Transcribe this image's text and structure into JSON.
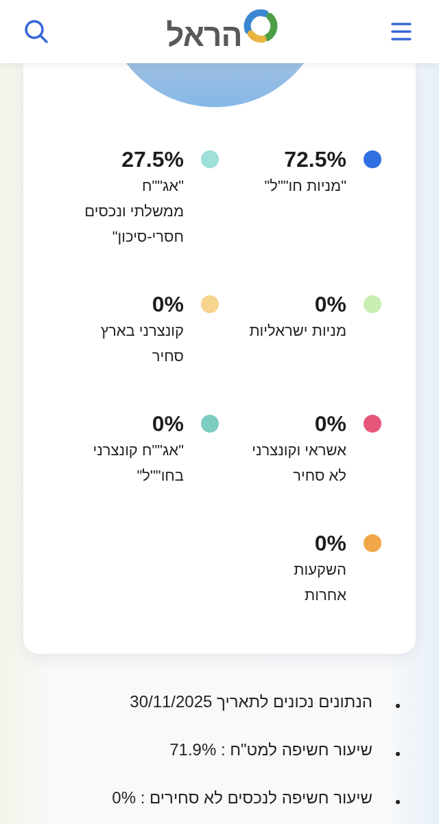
{
  "header": {
    "brand_name": "הראל"
  },
  "chart": {
    "legend": [
      {
        "percent": "72.5%",
        "label": "\"מניות חו\"\"ל\"",
        "color": "#2f6fe0"
      },
      {
        "percent": "27.5%",
        "label": "\"אג\"\"ח\nממשלתי ונכסים\nחסרי-סיכון\"",
        "color": "#9fdfd9"
      },
      {
        "percent": "0%",
        "label": "מניות ישראליות",
        "color": "#c8eeb4"
      },
      {
        "percent": "0%",
        "label": "קונצרני בארץ\nסחיר",
        "color": "#f6d48d"
      },
      {
        "percent": "0%",
        "label": "אשראי וקונצרני\nלא סחיר",
        "color": "#e5577a"
      },
      {
        "percent": "0%",
        "label": "\"אג\"\"ח קונצרני\nבחו\"\"ל\"",
        "color": "#7ecbc2"
      },
      {
        "percent": "0%",
        "label": "השקעות\nאחרות",
        "color": "#f1a748"
      }
    ]
  },
  "notes": [
    "הנתונים נכונים לתאריך 30/11/2025",
    "שיעור חשיפה למט\"ח : 71.9%",
    "שיעור חשיפה לנכסים לא סחירים : 0%"
  ]
}
